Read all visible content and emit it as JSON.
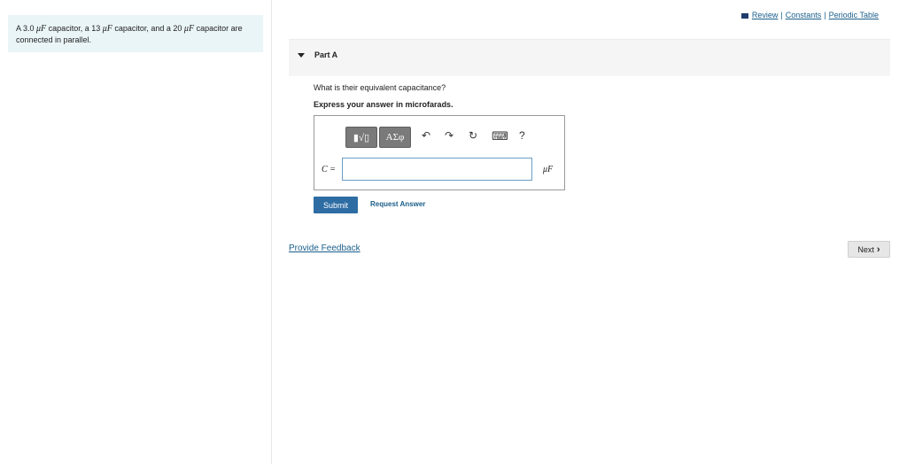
{
  "problem": {
    "prefix": "A 3.0 ",
    "unit1": "μF",
    "mid1": " capacitor, a 13 ",
    "unit2": "μF",
    "mid2": " capacitor, and a 20 ",
    "unit3": "μF",
    "suffix": " capacitor are connected in parallel."
  },
  "top_links": {
    "review": "Review",
    "sep1": "|",
    "constants": "Constants",
    "sep2": "|",
    "periodic_table": "Periodic Table"
  },
  "part": {
    "title": "Part A"
  },
  "question": "What is their equivalent capacitance?",
  "instruction": "Express your answer in microfarads.",
  "toolbar": {
    "templates_label": "▮√▯",
    "symbols_label": "ΑΣφ",
    "undo": "↶",
    "redo": "↷",
    "reset": "↻",
    "keyboard": "⌨",
    "help": "?"
  },
  "answer": {
    "variable": "C =",
    "value": "",
    "unit": "μF"
  },
  "buttons": {
    "submit": "Submit",
    "request_answer": "Request Answer",
    "feedback": "Provide Feedback",
    "next": "Next",
    "next_arrow": "›"
  }
}
